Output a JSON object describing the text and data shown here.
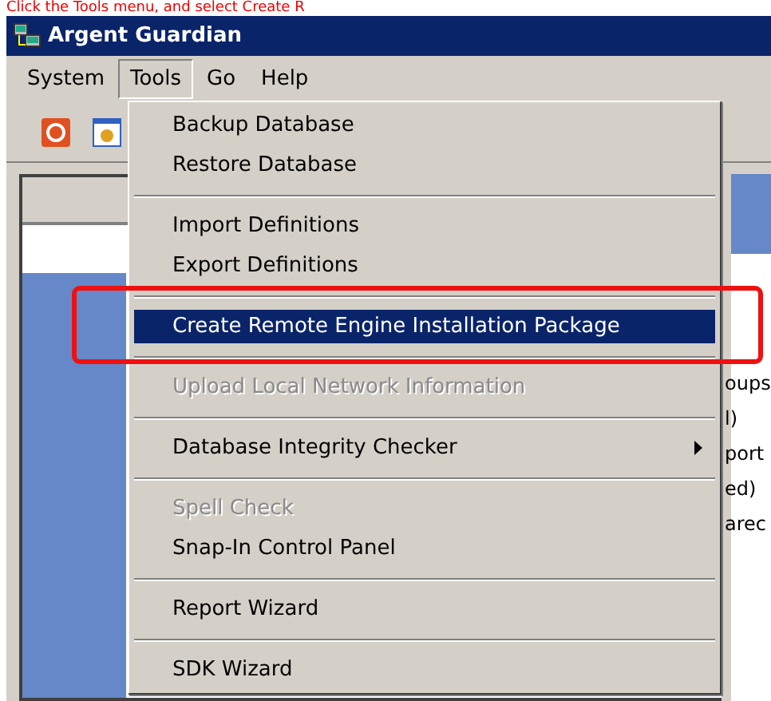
{
  "caption": "Click the Tools menu, and select Create R",
  "window": {
    "title": "Argent Guardian"
  },
  "menubar": [
    {
      "label": "System",
      "selected": false
    },
    {
      "label": "Tools",
      "selected": true
    },
    {
      "label": "Go",
      "selected": false
    },
    {
      "label": "Help",
      "selected": false
    }
  ],
  "tools_menu": [
    {
      "kind": "item",
      "label": "Backup Database",
      "disabled": false,
      "selected": false,
      "submenu": false
    },
    {
      "kind": "item",
      "label": "Restore Database",
      "disabled": false,
      "selected": false,
      "submenu": false
    },
    {
      "kind": "separator"
    },
    {
      "kind": "item",
      "label": "Import Definitions",
      "disabled": false,
      "selected": false,
      "submenu": false
    },
    {
      "kind": "item",
      "label": "Export Definitions",
      "disabled": false,
      "selected": false,
      "submenu": false
    },
    {
      "kind": "separator"
    },
    {
      "kind": "item",
      "label": "Create Remote Engine Installation Package",
      "disabled": false,
      "selected": true,
      "submenu": false
    },
    {
      "kind": "separator"
    },
    {
      "kind": "item",
      "label": "Upload Local Network Information",
      "disabled": true,
      "selected": false,
      "submenu": false
    },
    {
      "kind": "separator"
    },
    {
      "kind": "item",
      "label": "Database Integrity Checker",
      "disabled": false,
      "selected": false,
      "submenu": true
    },
    {
      "kind": "separator"
    },
    {
      "kind": "item",
      "label": "Spell Check",
      "disabled": true,
      "selected": false,
      "submenu": false
    },
    {
      "kind": "item",
      "label": "Snap-In Control Panel",
      "disabled": false,
      "selected": false,
      "submenu": false
    },
    {
      "kind": "separator"
    },
    {
      "kind": "item",
      "label": "Report Wizard",
      "disabled": false,
      "selected": false,
      "submenu": false
    },
    {
      "kind": "separator"
    },
    {
      "kind": "item",
      "label": "SDK Wizard",
      "disabled": false,
      "selected": false,
      "submenu": false
    }
  ],
  "right_panel_fragments": [
    "oups",
    "l)",
    "port",
    "ed)",
    "arec"
  ]
}
